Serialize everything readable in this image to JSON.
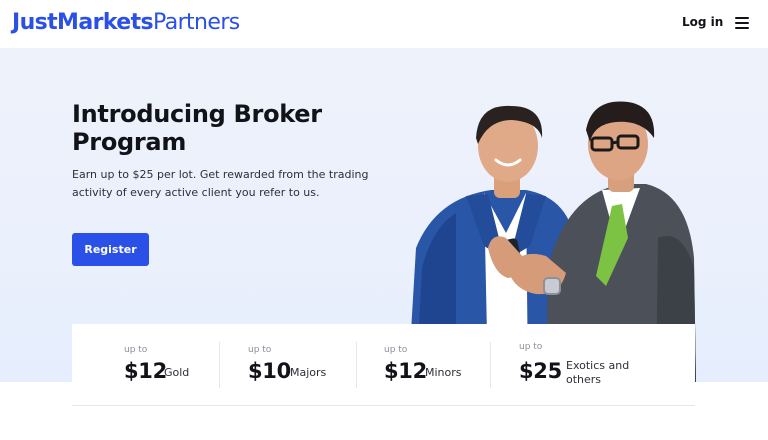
{
  "header": {
    "logo_brand": "JustMarkets",
    "logo_sub": "Partners",
    "login_label": "Log in",
    "menu_icon": "hamburger-menu-icon"
  },
  "hero": {
    "title": "Introducing Broker Program",
    "description": "Earn up to $25 per lot. Get rewarded from the trading activity of every active client you refer to us.",
    "register_label": "Register",
    "photo_subject": "two-businessmen-looking-at-phone"
  },
  "stats": [
    {
      "prefix": "up to",
      "amount": "$12",
      "label": "Gold"
    },
    {
      "prefix": "up to",
      "amount": "$10",
      "label": "Majors"
    },
    {
      "prefix": "up to",
      "amount": "$12",
      "label": "Minors"
    },
    {
      "prefix": "up to",
      "amount": "$25",
      "label": "Exotics and others"
    }
  ],
  "colors": {
    "accent": "#2b50e8",
    "hero_bg": "#eaf0fc",
    "text": "#111318"
  }
}
